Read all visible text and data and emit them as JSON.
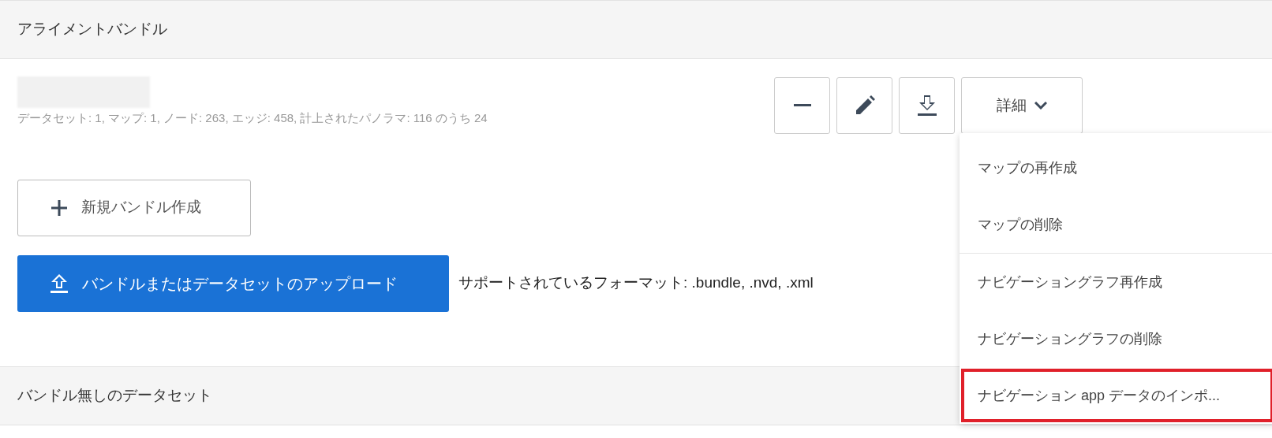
{
  "sections": [
    {
      "title": "アライメントバンドル"
    },
    {
      "title": "バンドル無しのデータセット"
    }
  ],
  "bundle": {
    "stats": "データセット: 1, マップ: 1, ノード: 263, エッジ: 458, 計上されたパノラマ: 116 のうち 24"
  },
  "actions": [
    {
      "kind": "minus"
    },
    {
      "kind": "pencil"
    },
    {
      "kind": "download"
    },
    {
      "kind": "more",
      "label": "詳細"
    }
  ],
  "menu": {
    "groups": [
      [
        {
          "label": "マップの再作成",
          "highlighted": false
        },
        {
          "label": "マップの削除",
          "highlighted": false
        }
      ],
      [
        {
          "label": "ナビゲーショングラフ再作成",
          "highlighted": false
        },
        {
          "label": "ナビゲーショングラフの削除",
          "highlighted": false
        },
        {
          "label": "ナビゲーション app データのインポ...",
          "highlighted": true
        }
      ]
    ]
  },
  "new_bundle_button": {
    "label": "新規バンドル作成"
  },
  "upload_button": {
    "label": "バンドルまたはデータセットのアップロード"
  },
  "formats_note": "サポートされているフォーマット: .bundle, .nvd, .xml"
}
